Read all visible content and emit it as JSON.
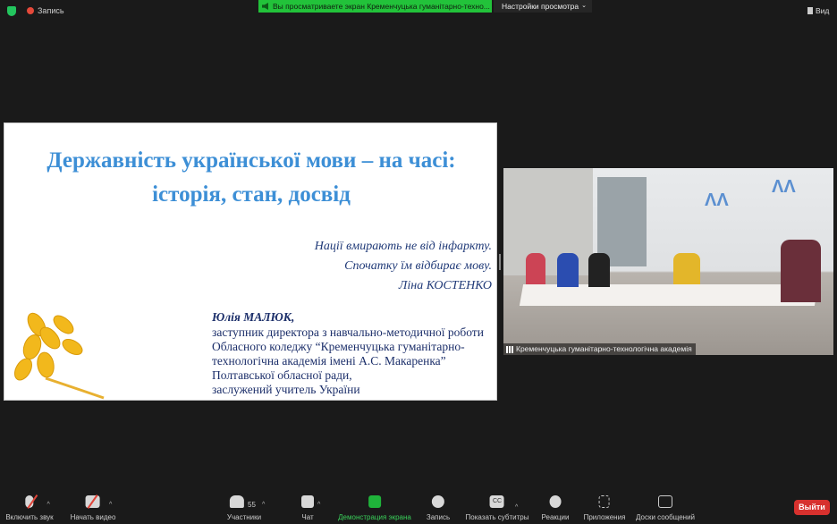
{
  "topbar": {
    "record_label": "Запись",
    "share_banner": "Вы просматриваете экран Кременчуцька гуманітарно-техно...",
    "view_options": "Настройки просмотра",
    "view_button": "Вид"
  },
  "slide": {
    "title_line1": "Державність української мови – на часі:",
    "title_line2": "історія, стан, досвід",
    "quote_line1": "Нації вмирають не від інфаркту.",
    "quote_line2": "Спочатку їм відбирає мову.",
    "quote_author": "Ліна КОСТЕНКО",
    "speaker_name": "Юлія МАЛЮК",
    "speaker_lines": [
      "заступник директора з навчально-методичної роботи",
      "Обласного коледжу “Кременчуцька гуманітарно-",
      "технологічна академія імені А.С. Макаренка”",
      "Полтавської обласної ради,",
      "заслужений учитель України"
    ]
  },
  "video": {
    "participant_name": "Кременчуцька гуманітарно-технологічна академія"
  },
  "toolbar": {
    "unmute": "Включить звук",
    "start_video": "Начать видео",
    "participants": "Участники",
    "participants_count": "55",
    "chat": "Чат",
    "share_screen": "Демонстрация экрана",
    "record": "Запись",
    "captions": "Показать субтитры",
    "reactions": "Реакции",
    "apps": "Приложения",
    "whiteboards": "Доски сообщений",
    "leave": "Выйти"
  },
  "colors": {
    "banner": "#22c23a",
    "leave": "#d7312e",
    "title": "#3d8fd6"
  }
}
